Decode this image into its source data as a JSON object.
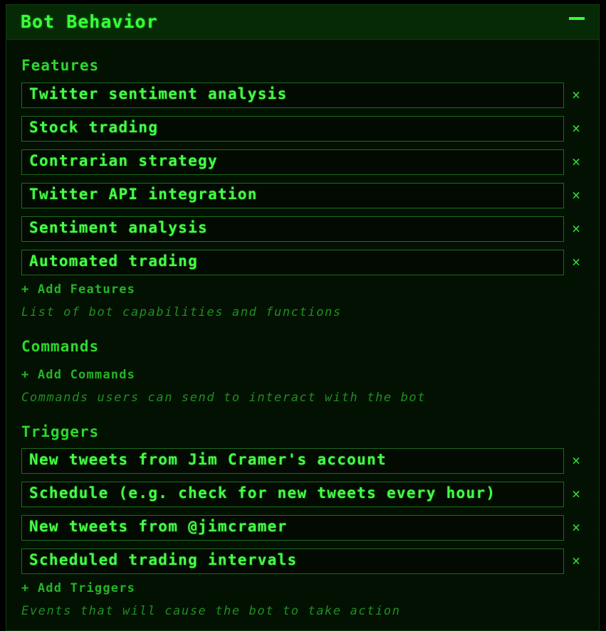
{
  "panel": {
    "title": "Bot Behavior",
    "collapse_icon": "minus-icon"
  },
  "features": {
    "label": "Features",
    "items": [
      "Twitter sentiment analysis",
      "Stock trading",
      "Contrarian strategy",
      "Twitter API integration",
      "Sentiment analysis",
      "Automated trading"
    ],
    "add_label": "+ Add Features",
    "hint": "List of bot capabilities and functions"
  },
  "commands": {
    "label": "Commands",
    "items": [],
    "add_label": "+ Add Commands",
    "hint": "Commands users can send to interact with the bot"
  },
  "triggers": {
    "label": "Triggers",
    "items": [
      "New tweets from Jim Cramer's account",
      "Schedule (e.g. check for new tweets every hour)",
      "New tweets from @jimcramer",
      "Scheduled trading intervals"
    ],
    "add_label": "+ Add Triggers",
    "hint": "Events that will cause the bot to take action"
  },
  "remove_glyph": "×",
  "colors": {
    "accent": "#39ff39",
    "background": "#000000",
    "panel": "#031203",
    "header": "#062a06",
    "hint": "#1f8f1f"
  }
}
